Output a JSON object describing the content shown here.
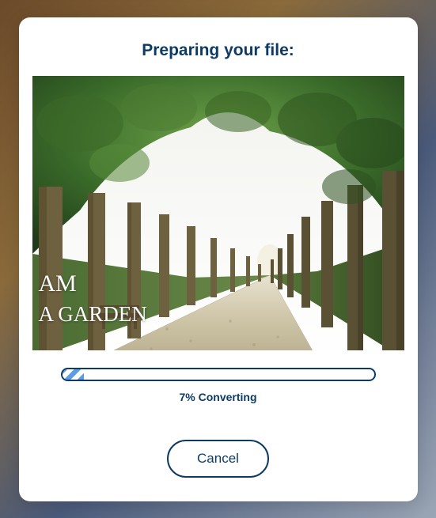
{
  "modal": {
    "title": "Preparing your file:",
    "preview": {
      "overlay_line1": "AM",
      "overlay_line2": "A GARDEN"
    },
    "progress": {
      "percent": 7,
      "label": "7% Converting"
    },
    "cancel_label": "Cancel"
  },
  "colors": {
    "brand": "#0d3b66",
    "progress_stripe": "#5a9de0"
  }
}
